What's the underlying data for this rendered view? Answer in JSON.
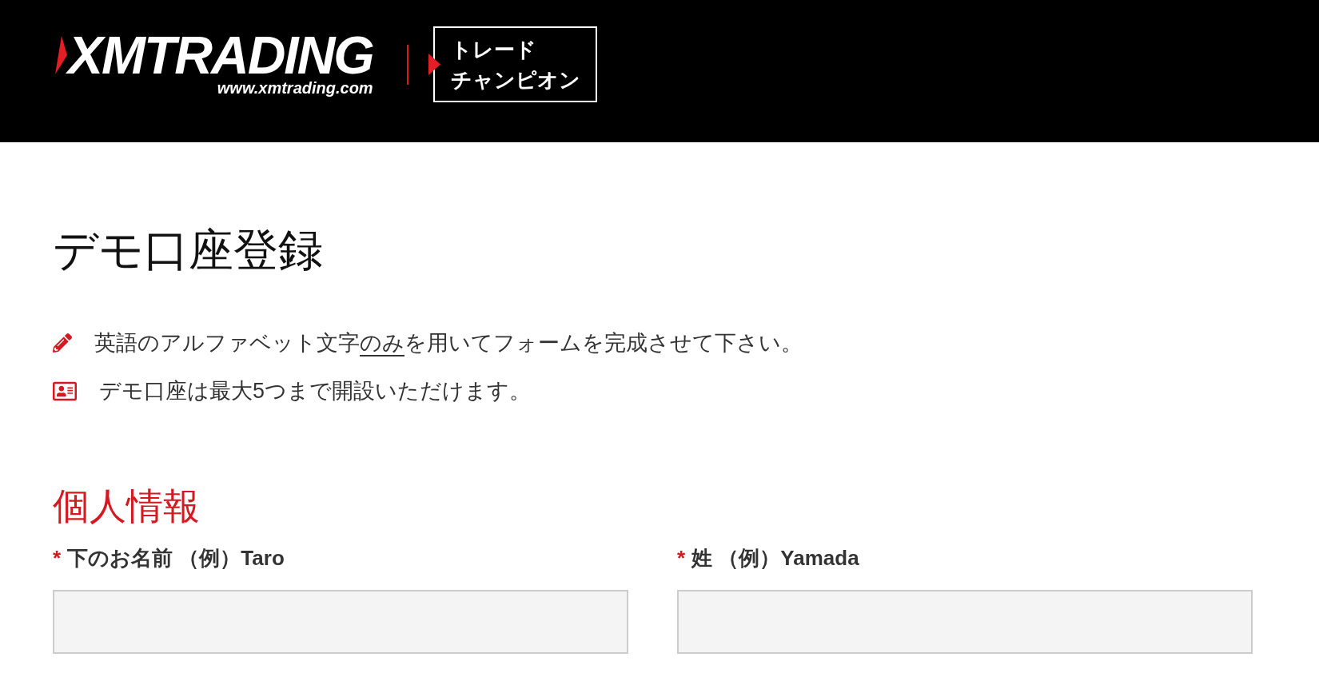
{
  "header": {
    "logo": {
      "wordmark": "XMTRADING",
      "url": "www.xmtrading.com"
    },
    "badge": {
      "lines": [
        "トレード",
        "チャンピオン"
      ]
    }
  },
  "title": "デモ口座登録",
  "notices": [
    {
      "kind": "pencil",
      "parts": [
        {
          "text": "英語のアルファベット文字",
          "underline": false
        },
        {
          "text": "のみ",
          "underline": true
        },
        {
          "text": "を用いてフォームを完成させて下さい。",
          "underline": false
        }
      ]
    },
    {
      "kind": "id-card",
      "parts": [
        {
          "text": "デモ口座は最大5つまで開設いただけます。",
          "underline": false
        }
      ]
    }
  ],
  "section": {
    "title": "個人情報",
    "fields": [
      {
        "required_mark": "*",
        "label": "下のお名前 （例）Taro"
      },
      {
        "required_mark": "*",
        "label": "姓 （例）Yamada"
      }
    ]
  }
}
